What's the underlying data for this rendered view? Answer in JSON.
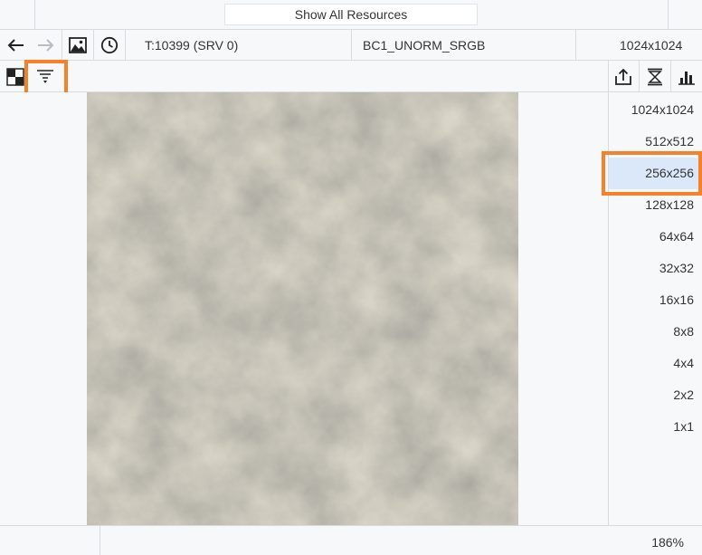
{
  "topbar": {
    "show_all_label": "Show All Resources"
  },
  "infobar": {
    "texture_id": "T:10399 (SRV 0)",
    "format": "BC1_UNORM_SRGB",
    "dimensions": "1024x1024"
  },
  "icons": {
    "back": "arrow-left-icon",
    "forward": "arrow-right-icon",
    "image": "image-icon",
    "history": "clock-icon",
    "checker": "checkerboard-icon",
    "filter": "filter-icon",
    "export": "export-icon",
    "fit": "fit-vertical-icon",
    "histogram": "histogram-icon"
  },
  "mips": [
    {
      "label": "1024x1024",
      "selected": false
    },
    {
      "label": "512x512",
      "selected": false
    },
    {
      "label": "256x256",
      "selected": true
    },
    {
      "label": "128x128",
      "selected": false
    },
    {
      "label": "64x64",
      "selected": false
    },
    {
      "label": "32x32",
      "selected": false
    },
    {
      "label": "16x16",
      "selected": false
    },
    {
      "label": "8x8",
      "selected": false
    },
    {
      "label": "4x4",
      "selected": false
    },
    {
      "label": "2x2",
      "selected": false
    },
    {
      "label": "1x1",
      "selected": false
    }
  ],
  "status": {
    "zoom": "186%"
  },
  "colors": {
    "highlight": "#f5822a",
    "selection": "#dbe8fa"
  }
}
